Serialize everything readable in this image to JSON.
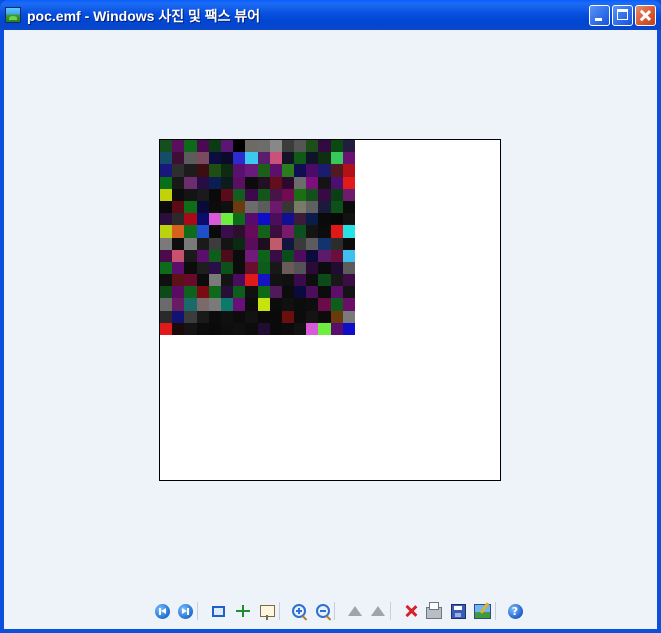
{
  "window": {
    "title": "poc.emf - Windows 사진 및 팩스 뷰어",
    "controls": [
      {
        "name": "minimize-button",
        "icon": "minimize-icon"
      },
      {
        "name": "maximize-button",
        "icon": "maximize-icon"
      },
      {
        "name": "close-button",
        "icon": "close-icon"
      }
    ]
  },
  "viewer": {
    "canvas_background": "#FFFFFF",
    "mosaic_colors": [
      [
        "#164F1E",
        "#5A0F5E",
        "#0C6A18",
        "#4A0A52",
        "#0A3C14",
        "#5C1574",
        "#000000",
        "#6C6A62",
        "#6C6C6C",
        "#888888",
        "#3C3C3C",
        "#555555",
        "#1C4E1A",
        "#300A40",
        "#0A4A10",
        "#241C3E"
      ],
      [
        "#144C6A",
        "#3E0E34",
        "#5C5C5C",
        "#7A4A5E",
        "#0C0C3E",
        "#0A0A2A",
        "#2C2CCE",
        "#3CC8F0",
        "#5A1E6C",
        "#C8527A",
        "#141426",
        "#0E5A16",
        "#101428",
        "#0F2E12",
        "#36C85C",
        "#6A1274"
      ],
      [
        "#18187C",
        "#2E2E2E",
        "#1C1C1C",
        "#3C0E12",
        "#1E4E14",
        "#0E2A10",
        "#5A1070",
        "#6A1A7A",
        "#1A601A",
        "#5E0E6C",
        "#2A7C1C",
        "#0E0E50",
        "#4A0C66",
        "#1C1C6C",
        "#501A20",
        "#B01218"
      ],
      [
        "#0A6E18",
        "#181818",
        "#6A2E6E",
        "#280C46",
        "#0A1E52",
        "#0C1C1C",
        "#5C0E62",
        "#0C0C0C",
        "#241024",
        "#640E1C",
        "#2C0A2E",
        "#6C6C6C",
        "#7C0E7E",
        "#141414",
        "#4C0E70",
        "#E21A1A"
      ],
      [
        "#C2D20A",
        "#0C0C0C",
        "#141414",
        "#1A1A1A",
        "#0A0A0A",
        "#5C0A1A",
        "#125E1E",
        "#3C0A4C",
        "#14561A",
        "#461446",
        "#740A52",
        "#1C6E14",
        "#14501C",
        "#380A44",
        "#0C3E14",
        "#701A6E"
      ],
      [
        "#0A0A0A",
        "#5C0A14",
        "#0E6E16",
        "#0A0A3A",
        "#0C0C0C",
        "#101010",
        "#6C3A0C",
        "#6C6C6C",
        "#5C5C5C",
        "#6E186C",
        "#363636",
        "#7A7A6A",
        "#606060",
        "#1A1A3A",
        "#0C501A",
        "#0C0C0C"
      ],
      [
        "#2C0E3C",
        "#2A2A2A",
        "#A80A1A",
        "#0C0C6C",
        "#D85AD8",
        "#6CEF3E",
        "#0C6C18",
        "#5A0A6C",
        "#0E0EC8",
        "#4A0E5A",
        "#101090",
        "#3C1A3A",
        "#0C1C4A",
        "#0A0A0A",
        "#080808",
        "#121212"
      ],
      [
        "#BCD20E",
        "#D8601E",
        "#0E6C1A",
        "#1E4EC8",
        "#0A0A0A",
        "#3A0E4A",
        "#2C0E2E",
        "#680A5A",
        "#14621A",
        "#3C0E3E",
        "#7A1A6A",
        "#0C501E",
        "#141414",
        "#0C0C0C",
        "#E21818",
        "#26E2E6"
      ],
      [
        "#7A7A7A",
        "#0E0E0E",
        "#7A7A7A",
        "#1A1A1A",
        "#3C3C3C",
        "#141414",
        "#0A2A12",
        "#5A0C5C",
        "#1E0E1E",
        "#C05C6A",
        "#141440",
        "#3A3A3A",
        "#5C5C5C",
        "#14336C",
        "#2C2C2C",
        "#0C0C0C"
      ],
      [
        "#4C0C4C",
        "#C8526E",
        "#1A1A1A",
        "#5C0E6C",
        "#0C5E1A",
        "#4C0C1C",
        "#0C0C0C",
        "#701A7A",
        "#0E621A",
        "#380C44",
        "#0C4C1A",
        "#4E0C5C",
        "#0C0C3A",
        "#5C1A6A",
        "#6A0E3C",
        "#3CC0F0"
      ],
      [
        "#0C6C1C",
        "#5C0E6C",
        "#0C0C0C",
        "#1E1E1E",
        "#2A0E4A",
        "#0C501A",
        "#0C0C0C",
        "#6A0E2E",
        "#0E5C1C",
        "#181818",
        "#6A5A5A",
        "#545454",
        "#2C0A38",
        "#0C0C0C",
        "#200C30",
        "#5C5C5C"
      ],
      [
        "#101010",
        "#5C1018",
        "#6A0A2A",
        "#0C0C0C",
        "#7A7A7A",
        "#141414",
        "#4A0C5E",
        "#E01A1A",
        "#1414C0",
        "#121212",
        "#101010",
        "#3A0A4A",
        "#0E0E0E",
        "#0C4A1A",
        "#181818",
        "#3C0C44"
      ],
      [
        "#0C4A1A",
        "#5A0C64",
        "#0E621C",
        "#7A0A14",
        "#0C6A1A",
        "#2A0E3A",
        "#0C5E1A",
        "#101010",
        "#0E6A14",
        "#501A5A",
        "#0C0C0C",
        "#0A0A3C",
        "#4A0E5A",
        "#0C0C0C",
        "#5C0E6A",
        "#141414"
      ],
      [
        "#6A6A6A",
        "#681C64",
        "#1A6A6A",
        "#7A6A6A",
        "#7A7A7A",
        "#0C7A6A",
        "#6A0E7A",
        "#0C0C0C",
        "#C8E20E",
        "#0C0C0C",
        "#101010",
        "#0C0C0C",
        "#0E0E0E",
        "#6A0C4A",
        "#0C5E1A",
        "#6A0E6A"
      ],
      [
        "#2A2A2A",
        "#121272",
        "#3C3C3C",
        "#1A1A1A",
        "#0C0C0C",
        "#101010",
        "#0C0C0C",
        "#121212",
        "#0A0A0A",
        "#0A0A0A",
        "#6A0E0E",
        "#0C0C0C",
        "#141414",
        "#0C0C0C",
        "#6A3A0C",
        "#7A7A7A"
      ],
      [
        "#E01A1A",
        "#1C0A0A",
        "#141414",
        "#0C0C0C",
        "#0A0A0A",
        "#0E0E0E",
        "#101010",
        "#0C0C0C",
        "#200C30",
        "#0A0A0A",
        "#0C0C0C",
        "#121212",
        "#D85AD8",
        "#6CEF3E",
        "#5A0E6C",
        "#0E0EC8"
      ]
    ]
  },
  "toolbar": {
    "buttons": [
      {
        "name": "previous-image-button",
        "icon": "previous-icon",
        "group": 0
      },
      {
        "name": "next-image-button",
        "icon": "next-icon",
        "group": 0
      },
      {
        "name": "best-fit-button",
        "icon": "best-fit-icon",
        "group": 1
      },
      {
        "name": "actual-size-button",
        "icon": "actual-size-icon",
        "group": 1
      },
      {
        "name": "slideshow-button",
        "icon": "slideshow-icon",
        "group": 1
      },
      {
        "name": "zoom-in-button",
        "icon": "zoom-in-icon",
        "group": 2
      },
      {
        "name": "zoom-out-button",
        "icon": "zoom-out-icon",
        "group": 2
      },
      {
        "name": "rotate-clockwise-button",
        "icon": "rotate-clockwise-icon",
        "group": 3
      },
      {
        "name": "rotate-counterclockwise-button",
        "icon": "rotate-counterclockwise-icon",
        "group": 3
      },
      {
        "name": "delete-button",
        "icon": "delete-icon",
        "group": 4
      },
      {
        "name": "print-button",
        "icon": "print-icon",
        "group": 4
      },
      {
        "name": "save-as-button",
        "icon": "save-icon",
        "group": 4
      },
      {
        "name": "open-for-editing-button",
        "icon": "edit-icon",
        "group": 4
      },
      {
        "name": "help-button",
        "icon": "help-icon",
        "group": 5
      }
    ],
    "help_glyph": "?"
  }
}
